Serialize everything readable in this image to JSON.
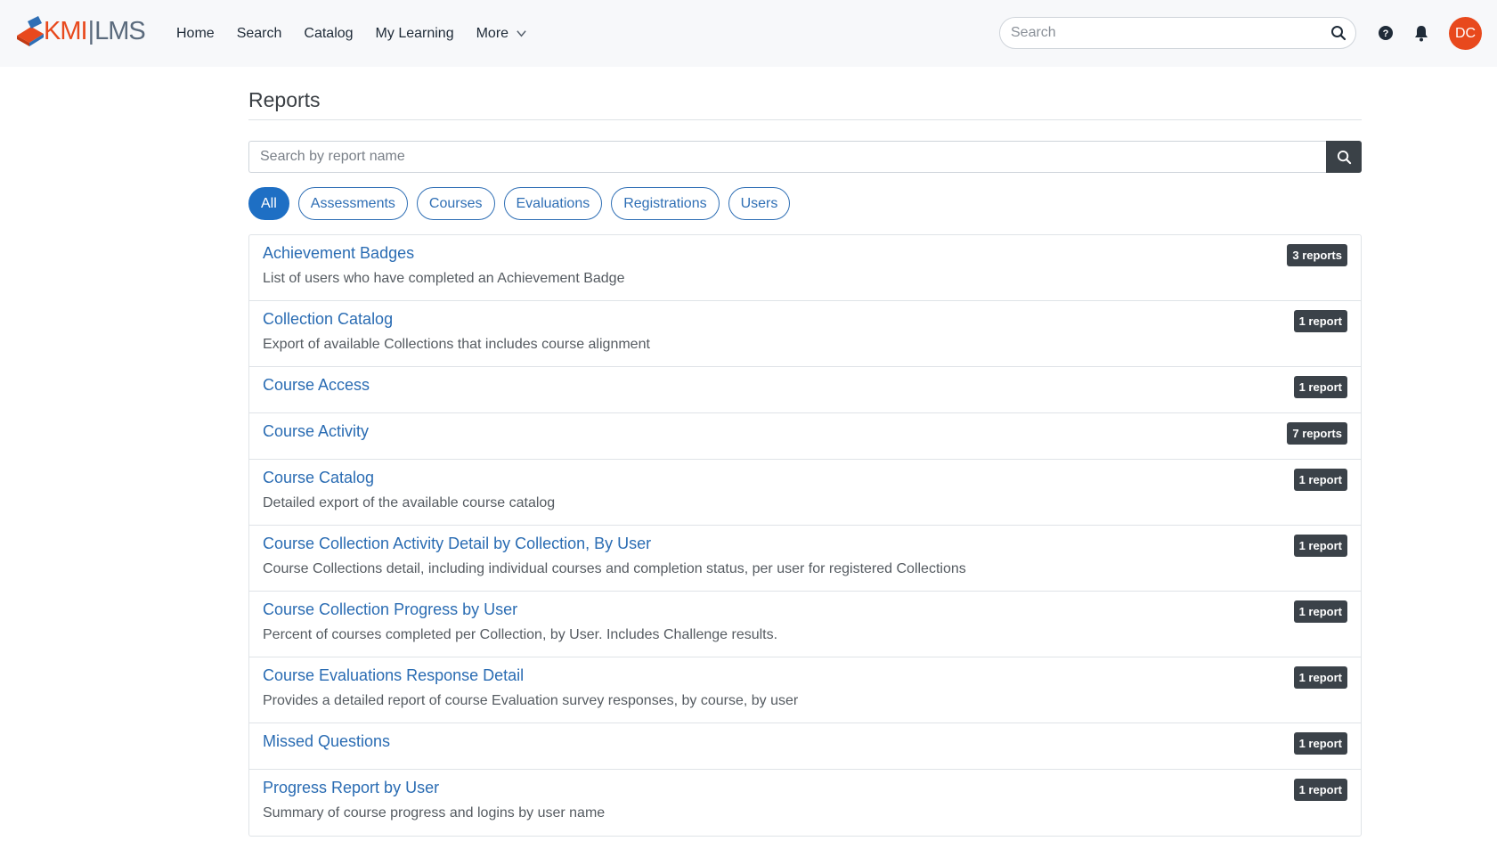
{
  "brand": {
    "kmi": "KMI",
    "sep": "|",
    "lms": "LMS"
  },
  "nav": {
    "home": "Home",
    "search": "Search",
    "catalog": "Catalog",
    "my_learning": "My Learning",
    "more": "More"
  },
  "top_search": {
    "placeholder": "Search"
  },
  "user": {
    "initials": "DC"
  },
  "page": {
    "title": "Reports"
  },
  "report_search": {
    "placeholder": "Search by report name"
  },
  "filters": [
    "All",
    "Assessments",
    "Courses",
    "Evaluations",
    "Registrations",
    "Users"
  ],
  "reports": [
    {
      "title": "Achievement Badges",
      "desc": "List of users who have completed an Achievement Badge",
      "count": "3 reports"
    },
    {
      "title": "Collection Catalog",
      "desc": "Export of available Collections that includes course alignment",
      "count": "1 report"
    },
    {
      "title": "Course Access",
      "desc": "",
      "count": "1 report"
    },
    {
      "title": "Course Activity",
      "desc": "",
      "count": "7 reports"
    },
    {
      "title": "Course Catalog",
      "desc": "Detailed export of the available course catalog",
      "count": "1 report"
    },
    {
      "title": "Course Collection Activity Detail by Collection, By User",
      "desc": "Course Collections detail, including individual courses and completion status, per user for registered Collections",
      "count": "1 report"
    },
    {
      "title": "Course Collection Progress by User",
      "desc": "Percent of courses completed per Collection, by User. Includes Challenge results.",
      "count": "1 report"
    },
    {
      "title": "Course Evaluations Response Detail",
      "desc": "Provides a detailed report of course Evaluation survey responses, by course, by user",
      "count": "1 report"
    },
    {
      "title": "Missed Questions",
      "desc": "",
      "count": "1 report"
    },
    {
      "title": "Progress Report by User",
      "desc": "Summary of course progress and logins by user name",
      "count": "1 report"
    }
  ],
  "colors": {
    "accent": "#e8491d",
    "link": "#2a6cb3",
    "active_pill": "#1e6fc4",
    "badge": "#3b4249"
  }
}
